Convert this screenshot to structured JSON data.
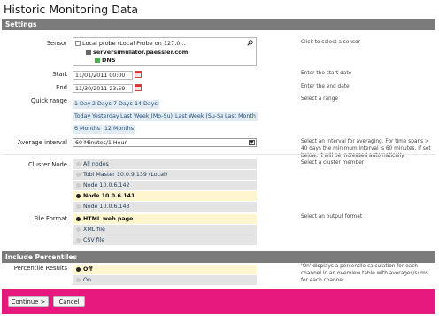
{
  "page_title": "Historic Monitoring Data",
  "settings_header": "Settings",
  "percentiles_header": "Include Percentiles",
  "sensor": {
    "label": "Sensor",
    "line1": "Local probe (Local Probe on 127.0...",
    "line2": "serversimulator.paessler.com",
    "line3": "DNS",
    "hint": "Click to select a sensor"
  },
  "start": {
    "label": "Start",
    "value": "11/01/2011 00:00",
    "hint": "Enter the start date"
  },
  "end": {
    "label": "End",
    "value": "11/30/2011 23:59",
    "hint": "Enter the end date"
  },
  "quick_range": {
    "label": "Quick range",
    "hint": "Select a range",
    "row1": [
      "1 Day",
      "2 Days",
      "7 Days",
      "14 Days"
    ],
    "row2": [
      "Today",
      "Yesterday",
      "Last Week (Mo-Su)",
      "Last Week (Su-Sa)",
      "Last Month"
    ],
    "row3": [
      "6 Months",
      "12 Months"
    ]
  },
  "average_interval": {
    "label": "Average interval",
    "value": "60 Minutes/1 Hour",
    "hint": "Select an interval for averaging. For time spans > 40 days the minimum interval is 60 minutes. If set below, it will be increased automatically."
  },
  "cluster_node": {
    "label": "Cluster Node",
    "hint": "Select a cluster member",
    "options": [
      "All nodes",
      "Tobi Master 10.0.9.139 (Local)",
      "Node 10.0.6.142",
      "Node 10.0.6.141",
      "Node 10.0.6.143"
    ],
    "selected": "Node 10.0.6.141"
  },
  "file_format": {
    "label": "File Format",
    "hint": "Select an output format",
    "options": [
      "HTML web page",
      "XML file",
      "CSV file"
    ],
    "selected": "HTML web page"
  },
  "percentile_results": {
    "label": "Percentile Results",
    "hint": "'On' displays a percentile calculation for each channel in an overview table with averages/sums for each channel.",
    "options": [
      "Off",
      "On"
    ],
    "selected": "Off"
  },
  "buttons": {
    "continue": "Continue >",
    "cancel": "Cancel"
  },
  "colors": {
    "footer": "#e8197e",
    "section_bar": "#7b7b7b",
    "selected_row": "#fff5cf",
    "link": "#1f4f7a"
  }
}
